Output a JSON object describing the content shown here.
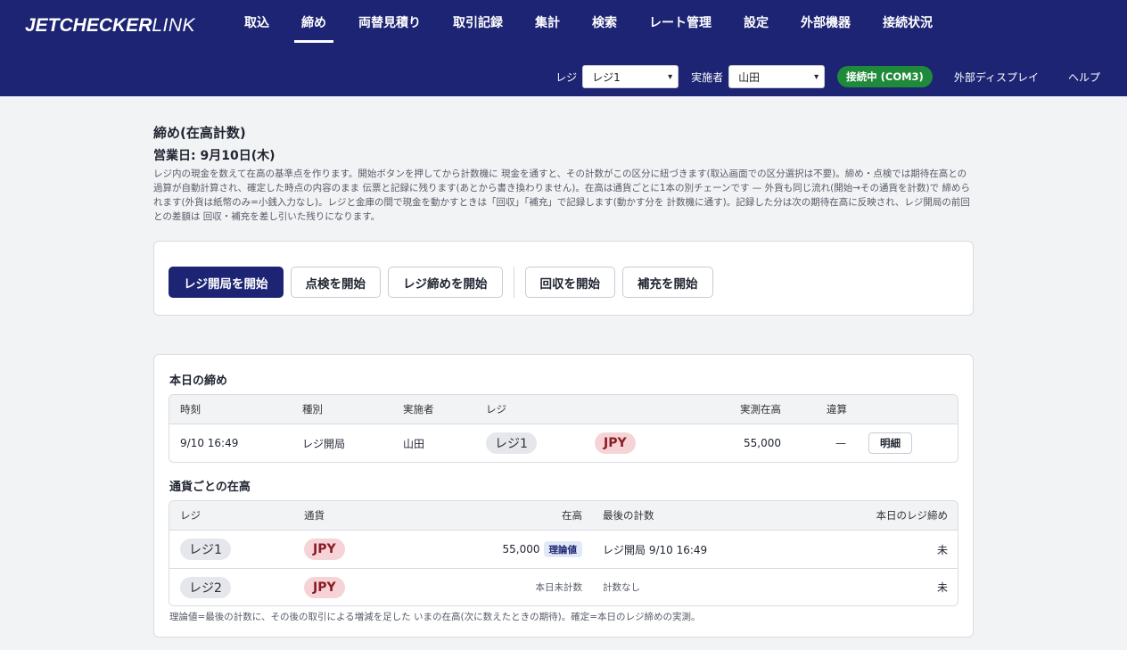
{
  "app": {
    "logo_bold": "JETCHECKER",
    "logo_light": "LINK"
  },
  "nav": {
    "items": [
      {
        "label": "取込"
      },
      {
        "label": "締め"
      },
      {
        "label": "両替見積り"
      },
      {
        "label": "取引記録"
      },
      {
        "label": "集計"
      },
      {
        "label": "検索"
      },
      {
        "label": "レート管理"
      },
      {
        "label": "設定"
      },
      {
        "label": "外部機器"
      },
      {
        "label": "接続状況"
      }
    ],
    "active": "締め"
  },
  "subbar": {
    "register_label": "レジ",
    "register_value": "レジ1",
    "operator_label": "実施者",
    "operator_value": "山田",
    "connection_status": "接続中 (COM3)",
    "external_display": "外部ディスプレイ",
    "help": "ヘルプ"
  },
  "page": {
    "title": "締め(在高計数)",
    "business_date": "営業日: 9月10日(木)",
    "description": "レジ内の現金を数えて在高の基準点を作ります。開始ボタンを押してから計数機に 現金を通すと、その計数がこの区分に紐づきます(取込画面での区分選択は不要)。締め・点検では期待在高との過算が自動計算され、確定した時点の内容のまま 伝票と記録に残ります(あとから書き換わりません)。在高は通貨ごとに1本の別チェーンです — 外貨も同じ流れ(開始→その通貨を計数)で 締められます(外貨は紙幣のみ=小銭入力なし)。レジと金庫の間で現金を動かすときは「回収」「補充」で記録します(動かす分を 計数機に通す)。記録した分は次の期待在高に反映され、レジ開局の前回との差額は 回収・補充を差し引いた残りになります。"
  },
  "actions": {
    "open_register": "レジ開局を開始",
    "inspection": "点検を開始",
    "close_register": "レジ締めを開始",
    "collect": "回収を開始",
    "replenish": "補充を開始"
  },
  "today": {
    "title": "本日の締め",
    "headers": {
      "time": "時刻",
      "type": "種別",
      "operator": "実施者",
      "register": "レジ",
      "counted": "実測在高",
      "variance": "違算"
    },
    "rows": [
      {
        "time": "9/10 16:49",
        "type": "レジ開局",
        "operator": "山田",
        "register": "レジ1",
        "currency": "JPY",
        "counted": "55,000",
        "variance": "—",
        "detail_button": "明細"
      }
    ]
  },
  "balances": {
    "title": "通貨ごとの在高",
    "headers": {
      "register": "レジ",
      "currency": "通貨",
      "balance": "在高",
      "last_count": "最後の計数",
      "today_close": "本日のレジ締め"
    },
    "rows": [
      {
        "register": "レジ1",
        "currency": "JPY",
        "balance": "55,000",
        "badge": "理論値",
        "last_count": "レジ開局 9/10 16:49",
        "today_close": "未"
      },
      {
        "register": "レジ2",
        "currency": "JPY",
        "balance": "本日未計数",
        "badge": "",
        "last_count": "計数なし",
        "today_close": "未"
      }
    ],
    "footnote": "理論値=最後の計数に、その後の取引による増減を足した いまの在高(次に数えたときの期待)。確定=本日のレジ締めの実測。"
  },
  "colors": {
    "header_bg": "#1c2473",
    "status_green": "#1f8a3a",
    "currency_chip_bg": "#f6d3d6",
    "currency_chip_text": "#8a1b24"
  }
}
